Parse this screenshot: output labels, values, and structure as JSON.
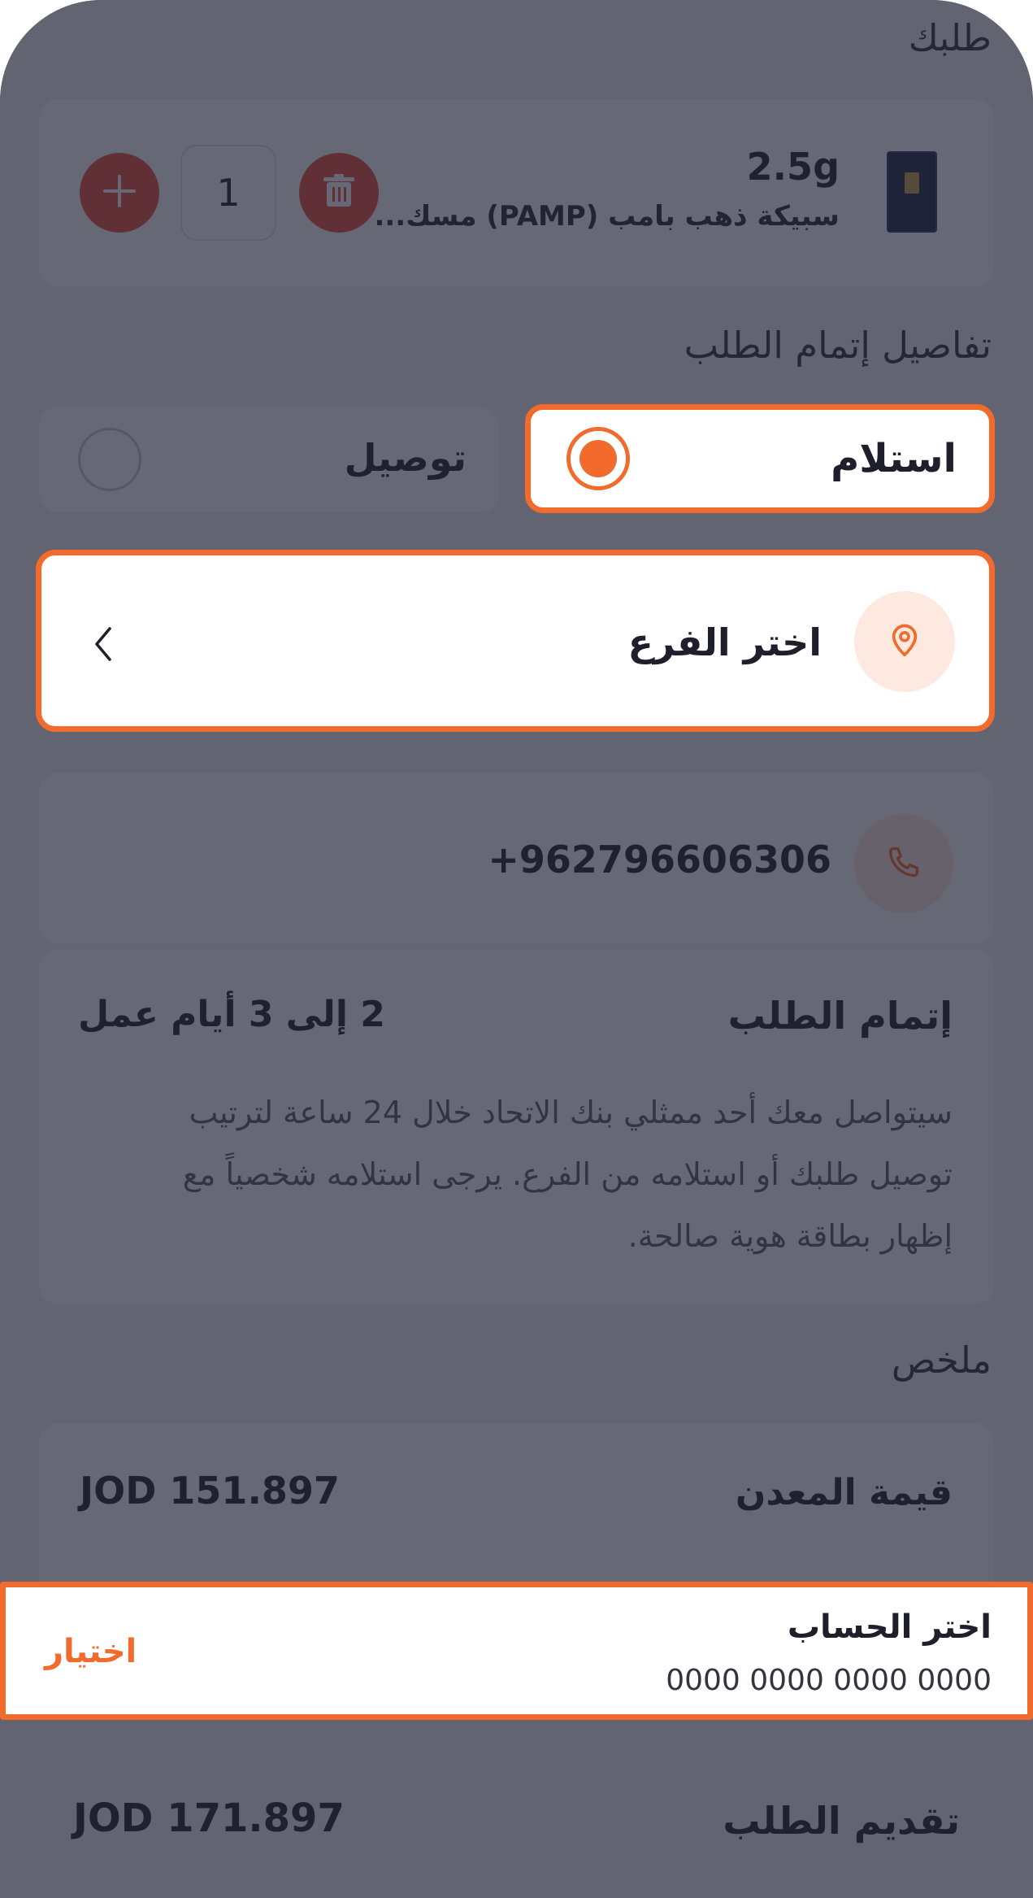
{
  "colors": {
    "accent": "#f26b2d",
    "overlay": "#595a69",
    "delete": "#e8533c",
    "text_dark": "#1f1f2b"
  },
  "order": {
    "title": "طلبك",
    "item": {
      "weight": "2.5g",
      "name": "سبيكة ذهب بامب (PAMP) مسك...",
      "quantity": "1"
    },
    "icons": {
      "delete": "trash-icon",
      "add": "plus-icon"
    }
  },
  "fulfillment": {
    "title": "تفاصيل إتمام الطلب",
    "options": [
      {
        "label": "استلام",
        "selected": true
      },
      {
        "label": "توصيل",
        "selected": false
      }
    ],
    "branch": {
      "label": "اختر الفرع",
      "icon": "location-pin-icon"
    },
    "phone": {
      "value": "+962796606306",
      "icon": "phone-icon"
    },
    "completion": {
      "label": "إتمام الطلب",
      "duration": "2 إلى 3 أيام عمل",
      "note_lines": [
        "سيتواصل معك أحد ممثلي بنك الاتحاد خلال 24 ساعة لترتيب",
        "توصيل طلبك أو استلامه من الفرع. يرجى استلامه شخصياً مع",
        "إظهار بطاقة هوية صالحة."
      ]
    }
  },
  "summary": {
    "title": "ملخص",
    "metal_value_label": "قيمة المعدن",
    "metal_value": "JOD 151.897"
  },
  "account": {
    "label": "اختر الحساب",
    "number": "0000 0000 0000 0000",
    "action": "اختيار"
  },
  "footer": {
    "submit_label": "تقديم الطلب",
    "total": "JOD 171.897"
  }
}
